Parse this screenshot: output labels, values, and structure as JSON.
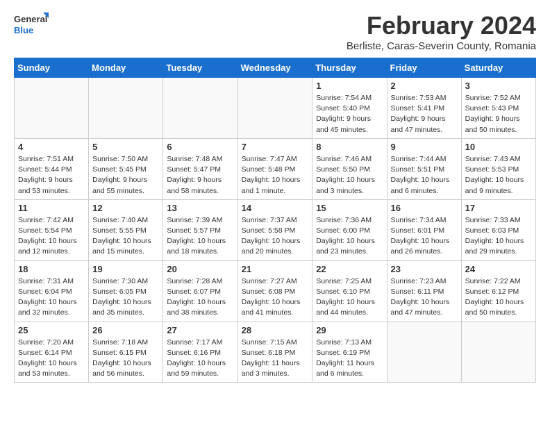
{
  "header": {
    "logo_general": "General",
    "logo_blue": "Blue",
    "month_title": "February 2024",
    "subtitle": "Berliste, Caras-Severin County, Romania"
  },
  "weekdays": [
    "Sunday",
    "Monday",
    "Tuesday",
    "Wednesday",
    "Thursday",
    "Friday",
    "Saturday"
  ],
  "weeks": [
    [
      {
        "day": "",
        "info": ""
      },
      {
        "day": "",
        "info": ""
      },
      {
        "day": "",
        "info": ""
      },
      {
        "day": "",
        "info": ""
      },
      {
        "day": "1",
        "info": "Sunrise: 7:54 AM\nSunset: 5:40 PM\nDaylight: 9 hours\nand 45 minutes."
      },
      {
        "day": "2",
        "info": "Sunrise: 7:53 AM\nSunset: 5:41 PM\nDaylight: 9 hours\nand 47 minutes."
      },
      {
        "day": "3",
        "info": "Sunrise: 7:52 AM\nSunset: 5:43 PM\nDaylight: 9 hours\nand 50 minutes."
      }
    ],
    [
      {
        "day": "4",
        "info": "Sunrise: 7:51 AM\nSunset: 5:44 PM\nDaylight: 9 hours\nand 53 minutes."
      },
      {
        "day": "5",
        "info": "Sunrise: 7:50 AM\nSunset: 5:45 PM\nDaylight: 9 hours\nand 55 minutes."
      },
      {
        "day": "6",
        "info": "Sunrise: 7:48 AM\nSunset: 5:47 PM\nDaylight: 9 hours\nand 58 minutes."
      },
      {
        "day": "7",
        "info": "Sunrise: 7:47 AM\nSunset: 5:48 PM\nDaylight: 10 hours\nand 1 minute."
      },
      {
        "day": "8",
        "info": "Sunrise: 7:46 AM\nSunset: 5:50 PM\nDaylight: 10 hours\nand 3 minutes."
      },
      {
        "day": "9",
        "info": "Sunrise: 7:44 AM\nSunset: 5:51 PM\nDaylight: 10 hours\nand 6 minutes."
      },
      {
        "day": "10",
        "info": "Sunrise: 7:43 AM\nSunset: 5:53 PM\nDaylight: 10 hours\nand 9 minutes."
      }
    ],
    [
      {
        "day": "11",
        "info": "Sunrise: 7:42 AM\nSunset: 5:54 PM\nDaylight: 10 hours\nand 12 minutes."
      },
      {
        "day": "12",
        "info": "Sunrise: 7:40 AM\nSunset: 5:55 PM\nDaylight: 10 hours\nand 15 minutes."
      },
      {
        "day": "13",
        "info": "Sunrise: 7:39 AM\nSunset: 5:57 PM\nDaylight: 10 hours\nand 18 minutes."
      },
      {
        "day": "14",
        "info": "Sunrise: 7:37 AM\nSunset: 5:58 PM\nDaylight: 10 hours\nand 20 minutes."
      },
      {
        "day": "15",
        "info": "Sunrise: 7:36 AM\nSunset: 6:00 PM\nDaylight: 10 hours\nand 23 minutes."
      },
      {
        "day": "16",
        "info": "Sunrise: 7:34 AM\nSunset: 6:01 PM\nDaylight: 10 hours\nand 26 minutes."
      },
      {
        "day": "17",
        "info": "Sunrise: 7:33 AM\nSunset: 6:03 PM\nDaylight: 10 hours\nand 29 minutes."
      }
    ],
    [
      {
        "day": "18",
        "info": "Sunrise: 7:31 AM\nSunset: 6:04 PM\nDaylight: 10 hours\nand 32 minutes."
      },
      {
        "day": "19",
        "info": "Sunrise: 7:30 AM\nSunset: 6:05 PM\nDaylight: 10 hours\nand 35 minutes."
      },
      {
        "day": "20",
        "info": "Sunrise: 7:28 AM\nSunset: 6:07 PM\nDaylight: 10 hours\nand 38 minutes."
      },
      {
        "day": "21",
        "info": "Sunrise: 7:27 AM\nSunset: 6:08 PM\nDaylight: 10 hours\nand 41 minutes."
      },
      {
        "day": "22",
        "info": "Sunrise: 7:25 AM\nSunset: 6:10 PM\nDaylight: 10 hours\nand 44 minutes."
      },
      {
        "day": "23",
        "info": "Sunrise: 7:23 AM\nSunset: 6:11 PM\nDaylight: 10 hours\nand 47 minutes."
      },
      {
        "day": "24",
        "info": "Sunrise: 7:22 AM\nSunset: 6:12 PM\nDaylight: 10 hours\nand 50 minutes."
      }
    ],
    [
      {
        "day": "25",
        "info": "Sunrise: 7:20 AM\nSunset: 6:14 PM\nDaylight: 10 hours\nand 53 minutes."
      },
      {
        "day": "26",
        "info": "Sunrise: 7:18 AM\nSunset: 6:15 PM\nDaylight: 10 hours\nand 56 minutes."
      },
      {
        "day": "27",
        "info": "Sunrise: 7:17 AM\nSunset: 6:16 PM\nDaylight: 10 hours\nand 59 minutes."
      },
      {
        "day": "28",
        "info": "Sunrise: 7:15 AM\nSunset: 6:18 PM\nDaylight: 11 hours\nand 3 minutes."
      },
      {
        "day": "29",
        "info": "Sunrise: 7:13 AM\nSunset: 6:19 PM\nDaylight: 11 hours\nand 6 minutes."
      },
      {
        "day": "",
        "info": ""
      },
      {
        "day": "",
        "info": ""
      }
    ]
  ]
}
